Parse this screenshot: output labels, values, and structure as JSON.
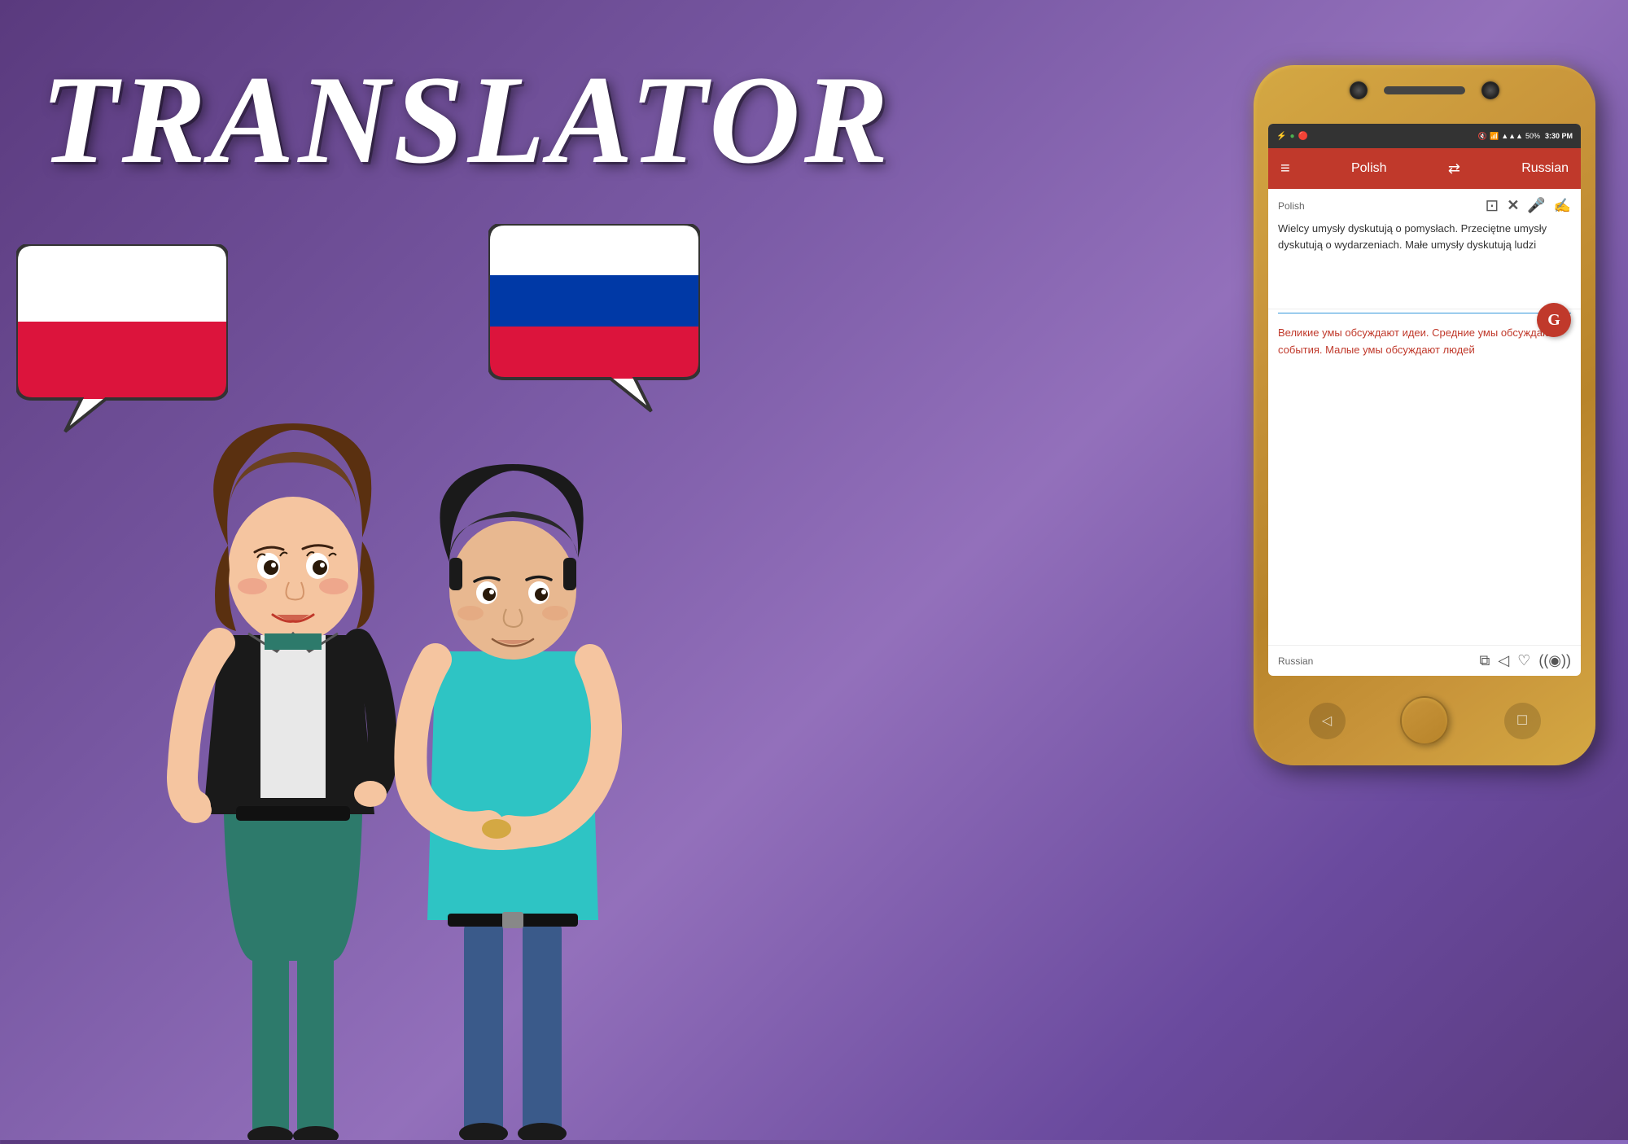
{
  "title": "TRANSLATOR",
  "background": {
    "gradient_start": "#5a3a7e",
    "gradient_end": "#6a4a9e"
  },
  "phone": {
    "status_bar": {
      "time": "3:30 PM",
      "battery": "50%",
      "signal": "▲▲▲",
      "wifi": "WiFi",
      "icons_left": "⚡🔴"
    },
    "header": {
      "menu_label": "≡",
      "source_lang": "Polish",
      "swap_icon": "⇄",
      "target_lang": "Russian"
    },
    "input": {
      "lang_label": "Polish",
      "copy_icon": "📋",
      "clear_icon": "✕",
      "mic_icon": "🎤",
      "handwrite_icon": "✍",
      "text": "Wielcy umysły dyskutują o pomysłach. Przeciętne umysły dyskutują o wydarzeniach. Małe umysły dyskutują ludzi"
    },
    "translate_btn_icon": "G",
    "output": {
      "text": "Великие умы обсуждают идеи. Средние умы обсуждают события. Малые умы обсуждают людей",
      "lang_label": "Russian",
      "copy_icon": "⧉",
      "share_icon": "◁",
      "favorite_icon": "♡",
      "listen_icon": "((◉))"
    },
    "bottom_buttons": {
      "back": "◁",
      "home": "",
      "recent": "☐"
    }
  },
  "flags": {
    "polish": {
      "colors": [
        "#ffffff",
        "#dc143c"
      ],
      "label": "Polish flag"
    },
    "russian": {
      "colors": [
        "#ffffff",
        "#0039a6",
        "#dc143c"
      ],
      "label": "Russian flag"
    }
  }
}
